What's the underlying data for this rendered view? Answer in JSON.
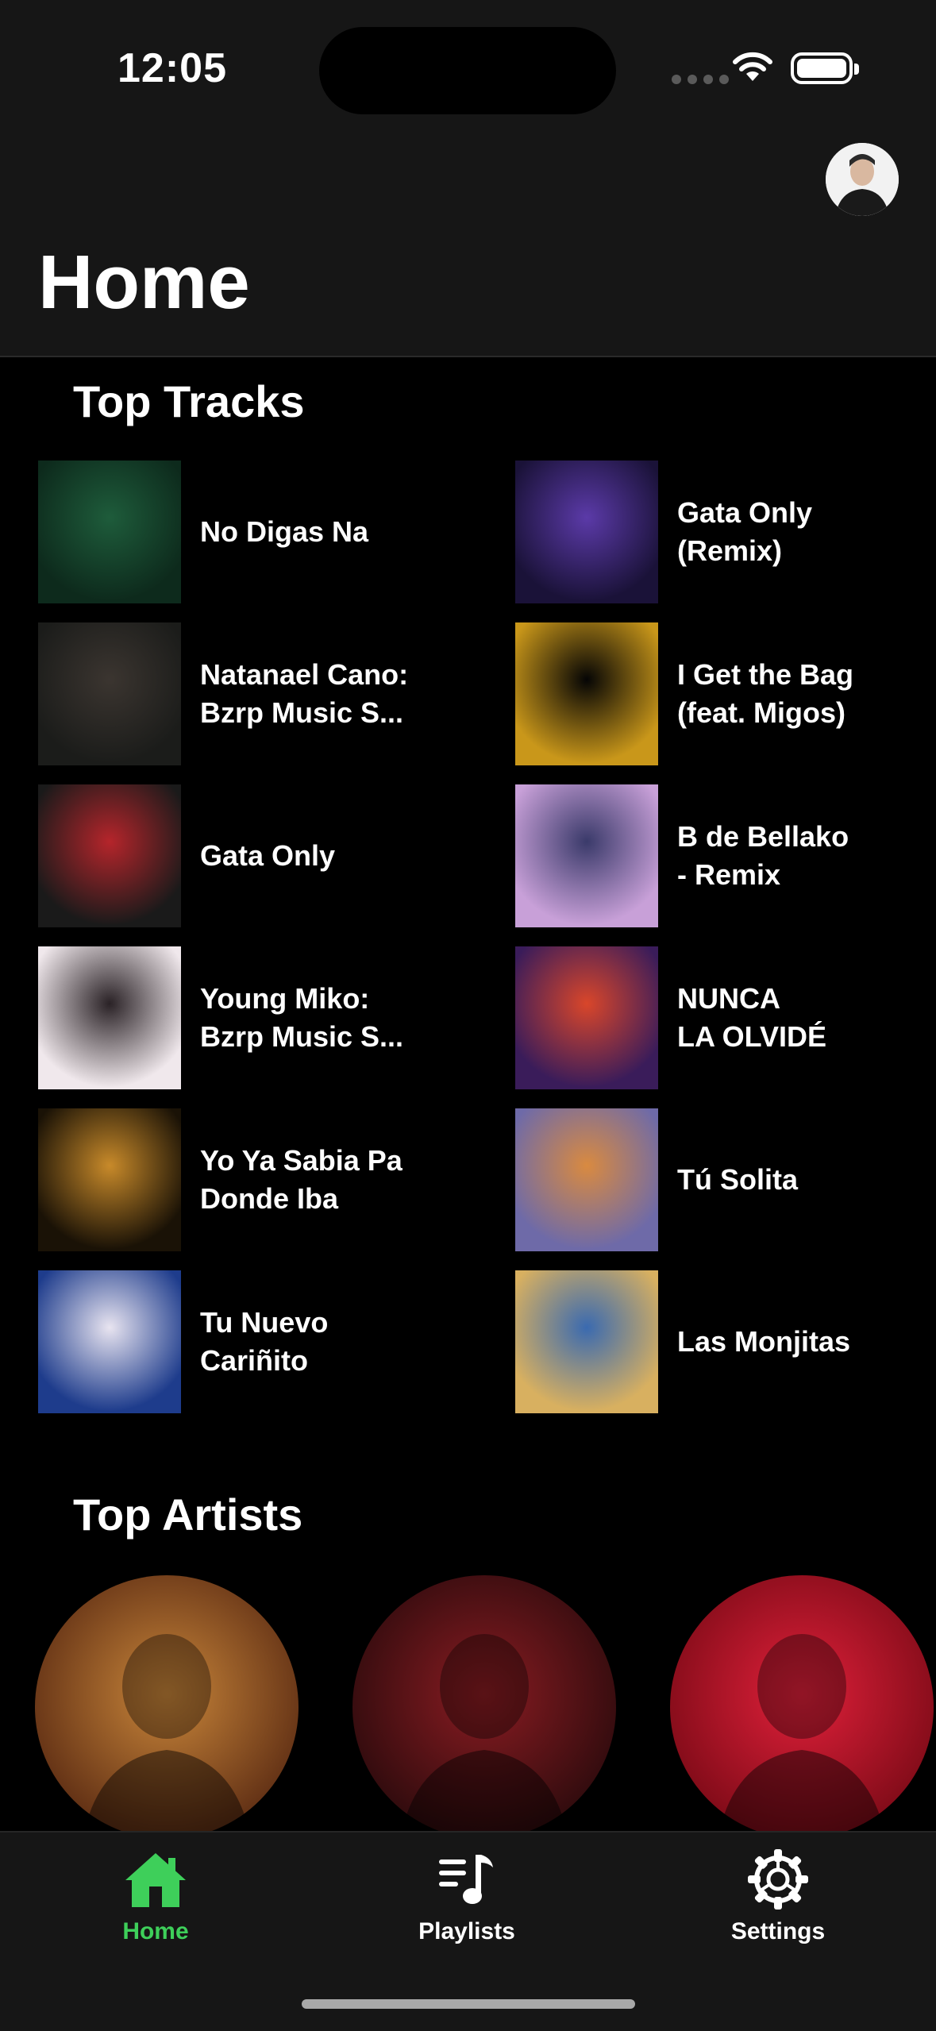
{
  "status_bar": {
    "time": "12:05"
  },
  "header": {
    "title": "Home",
    "avatar_icon": "profile-avatar"
  },
  "top_tracks": {
    "title": "Top Tracks",
    "items": [
      {
        "name": "No Digas Na",
        "cover_colors": [
          "#0d2a1c",
          "#1e5c3b"
        ]
      },
      {
        "name": "Gata Only\n(Remix)",
        "cover_colors": [
          "#1a1238",
          "#5b3aa8"
        ]
      },
      {
        "name": "Natanael Cano:\nBzrp Music S...",
        "cover_colors": [
          "#1b1c1a",
          "#3b3530"
        ]
      },
      {
        "name": "I Get the Bag\n(feat. Migos)",
        "cover_colors": [
          "#c9971a",
          "#050505"
        ]
      },
      {
        "name": "Gata Only",
        "cover_colors": [
          "#1a1a1a",
          "#b5252b"
        ]
      },
      {
        "name": "B de Bellako\n- Remix",
        "cover_colors": [
          "#c8a0d8",
          "#3a3a6a"
        ]
      },
      {
        "name": "Young Miko:\nBzrp Music S...",
        "cover_colors": [
          "#f0e8ec",
          "#2a2226"
        ]
      },
      {
        "name": "NUNCA\nLA OLVIDÉ",
        "cover_colors": [
          "#3a1c5a",
          "#d9462a"
        ]
      },
      {
        "name": "Yo Ya Sabia Pa\nDonde Iba",
        "cover_colors": [
          "#1a1206",
          "#c88a2a"
        ]
      },
      {
        "name": "Tú Solita",
        "cover_colors": [
          "#6e6aa8",
          "#d98a40"
        ]
      },
      {
        "name": "Tu Nuevo\nCariñito",
        "cover_colors": [
          "#1e3c8c",
          "#e8e4f0"
        ]
      },
      {
        "name": "Las Monjitas",
        "cover_colors": [
          "#d8b060",
          "#3a6ab0"
        ]
      }
    ]
  },
  "top_artists": {
    "title": "Top Artists",
    "items": [
      {
        "colors": [
          "#c9863a",
          "#5a2a12"
        ]
      },
      {
        "colors": [
          "#8a1c22",
          "#2a0a0c"
        ]
      },
      {
        "colors": [
          "#e0203a",
          "#7a0a16"
        ]
      }
    ]
  },
  "tab_bar": {
    "active_color": "#3ecf5a",
    "tabs": [
      {
        "label": "Home",
        "icon": "house-icon",
        "active": true
      },
      {
        "label": "Playlists",
        "icon": "playlist-icon",
        "active": false
      },
      {
        "label": "Settings",
        "icon": "gear-icon",
        "active": false
      }
    ]
  }
}
